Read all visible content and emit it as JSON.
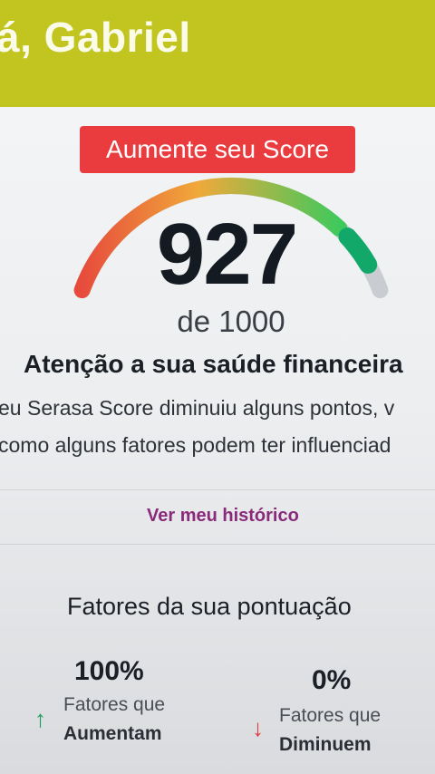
{
  "header": {
    "greeting": "á, Gabriel"
  },
  "overlay": {
    "text": "Aumente seu Score"
  },
  "score": {
    "value": "927",
    "max_text": "de 1000",
    "fraction": 0.927
  },
  "alert": {
    "title": "Atenção a sua saúde financeira",
    "line1": "eu Serasa Score diminuiu alguns pontos, v",
    "line2": "como alguns fatores podem ter influenciad"
  },
  "history": {
    "link_label": "Ver meu histórico"
  },
  "factors": {
    "title": "Fatores da sua pontuação",
    "increase": {
      "percent": "100%",
      "label1": "Fatores que",
      "label2": "Aumentam",
      "icon": "arrow-up-icon"
    },
    "decrease": {
      "percent": "0%",
      "label1": "Fatores que",
      "label2": "Diminuem",
      "icon": "arrow-down-icon"
    }
  },
  "colors": {
    "header_bg": "#c2c51f",
    "overlay_bg": "#ea3c3f",
    "link": "#8a2a7a",
    "gauge_low": "#e74b3c",
    "gauge_mid": "#f0a93a",
    "gauge_high": "#3fc95c",
    "gauge_indicator": "#12a86a",
    "gauge_track": "#c9ccd0",
    "up_arrow": "#1f9e5a",
    "down_arrow": "#e23b3b"
  }
}
